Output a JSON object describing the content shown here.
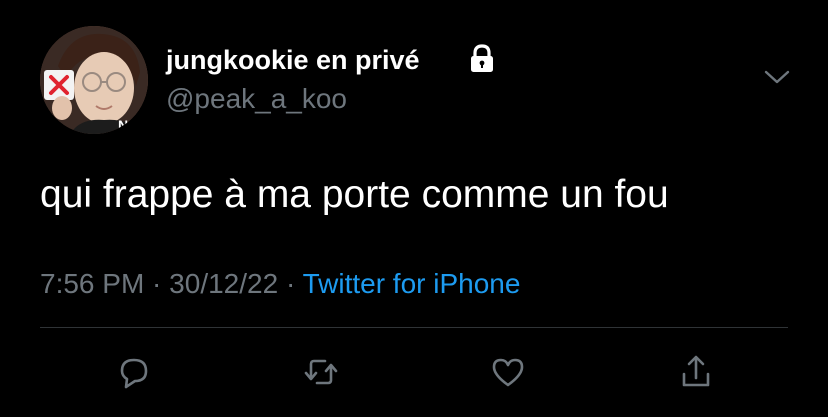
{
  "author": {
    "name": "jungkookie en privé",
    "handle": "@peak_a_koo",
    "protected_icon": "lock-icon",
    "avatar_icon": "profile-photo"
  },
  "tweet": {
    "text": "qui frappe à ma porte comme un fou",
    "time": "7:56 PM",
    "separator": " · ",
    "date": "30/12/22",
    "source": "Twitter for iPhone"
  },
  "actions": [
    {
      "name": "reply-icon"
    },
    {
      "name": "retweet-icon"
    },
    {
      "name": "like-icon"
    },
    {
      "name": "share-icon"
    }
  ],
  "colors": {
    "background": "#000000",
    "text": "#ffffff",
    "secondary": "#6e767d",
    "link": "#1d9bf0",
    "divider": "#2f3336"
  }
}
